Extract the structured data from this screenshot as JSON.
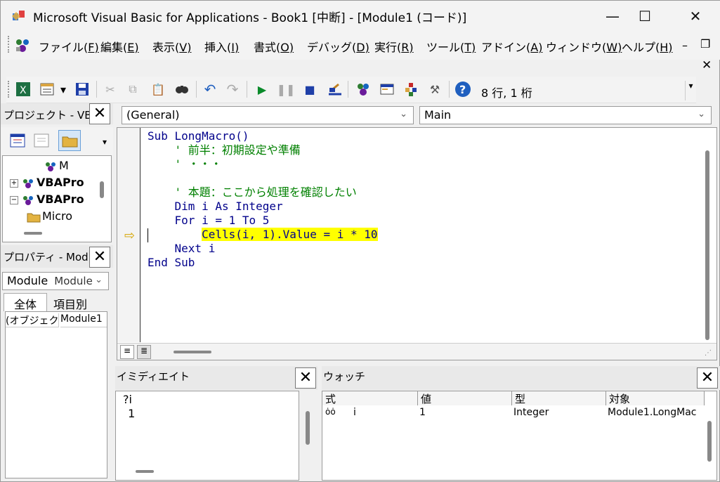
{
  "title_bar": {
    "title": "Microsoft Visual Basic for Applications - Book1 [中断] - [Module1 (コード)]",
    "minimize_glyph": "—",
    "maximize_glyph": "☐",
    "close_glyph": "✕"
  },
  "menu": {
    "items": [
      {
        "label": "ファイル(",
        "key": "F",
        "suffix": ")"
      },
      {
        "label": "編集(",
        "key": "E",
        "suffix": ")"
      },
      {
        "label": "表示(",
        "key": "V",
        "suffix": ")"
      },
      {
        "label": "挿入(",
        "key": "I",
        "suffix": ")"
      },
      {
        "label": "書式(",
        "key": "O",
        "suffix": ")"
      },
      {
        "label": "デバッグ(",
        "key": "D",
        "suffix": ")"
      },
      {
        "label": "実行(",
        "key": "R",
        "suffix": ")"
      },
      {
        "label": "ツール(",
        "key": "T",
        "suffix": ")"
      },
      {
        "label": "アドイン(",
        "key": "A",
        "suffix": ")"
      },
      {
        "label": "ウィンドウ(",
        "key": "W",
        "suffix": ")"
      },
      {
        "label": "ヘルプ(",
        "key": "H",
        "suffix": ")"
      }
    ],
    "mdi_min": "–",
    "mdi_restore": "❐",
    "mdi_close": "✕"
  },
  "toolbar": {
    "cursor_position": "8 行, 1 桁",
    "icons": [
      "view-excel-icon",
      "insert-module-icon",
      "dropdown-arrow-icon",
      "save-icon",
      "cut-icon",
      "copy-icon",
      "paste-icon",
      "find-icon",
      "undo-icon",
      "redo-icon",
      "run-icon",
      "break-icon",
      "reset-icon",
      "design-mode-icon",
      "project-explorer-icon",
      "properties-icon",
      "object-browser-icon",
      "toolbox-icon",
      "help-icon"
    ]
  },
  "project_pane": {
    "title": "プロジェクト - VBAP",
    "tree": [
      {
        "label": "M",
        "indent": 3
      },
      {
        "label": "VBAPro",
        "indent": 1,
        "toggle": "+"
      },
      {
        "label": "VBAPro",
        "indent": 1,
        "toggle": "−"
      },
      {
        "label": "Micro",
        "indent": 2
      }
    ]
  },
  "properties_pane": {
    "title": "プロパティ - Module",
    "object_name": "Module",
    "object_type": "Module",
    "tabs": [
      "全体",
      "項目別"
    ],
    "rows": [
      {
        "name": "(オブジェク",
        "value": "Module1"
      }
    ]
  },
  "code": {
    "object_combo": "(General)",
    "procedure_combo": "Main",
    "lines": [
      {
        "text": "Sub LongMacro()",
        "style": "kw"
      },
      {
        "text": "    ' 前半：初期設定や準備",
        "style": "cm"
      },
      {
        "text": "    ' ・・・",
        "style": "cm"
      },
      {
        "text": "",
        "style": ""
      },
      {
        "text": "    ' 本題：ここから処理を確認したい",
        "style": "cm"
      },
      {
        "text": "    Dim i As Integer",
        "style": "kw"
      },
      {
        "text": "    For i = 1 To 5",
        "style": "kw"
      },
      {
        "text": "        Cells(i, 1).Value = i * 10",
        "style": "hl"
      },
      {
        "text": "    Next i",
        "style": "kw"
      },
      {
        "text": "End Sub",
        "style": "kw"
      }
    ],
    "execution_arrow": "⇨"
  },
  "immediate": {
    "title": "イミディエイト",
    "lines": [
      "?i",
      " 1"
    ]
  },
  "watch": {
    "title": "ウォッチ",
    "headers": [
      "式",
      "値",
      "型",
      "対象"
    ],
    "rows": [
      {
        "icon": "ȯȯ",
        "expr": "i",
        "value": "1",
        "type": "Integer",
        "context": "Module1.LongMac"
      }
    ]
  }
}
